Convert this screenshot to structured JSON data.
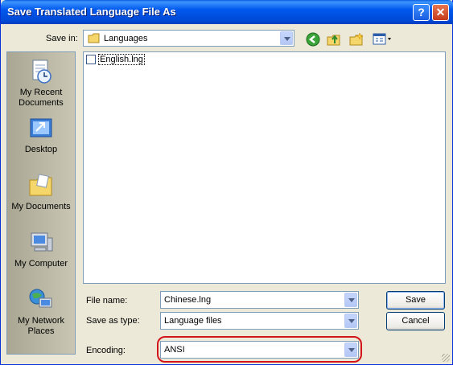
{
  "window": {
    "title": "Save Translated Language File As"
  },
  "toolbar": {
    "save_in_label": "Save in:",
    "folder": "Languages"
  },
  "places": [
    {
      "label": "My Recent Documents"
    },
    {
      "label": "Desktop"
    },
    {
      "label": "My Documents"
    },
    {
      "label": "My Computer"
    },
    {
      "label": "My Network Places"
    }
  ],
  "files": [
    {
      "name": "English.lng"
    }
  ],
  "form": {
    "file_name_label": "File name:",
    "file_name_value": "Chinese.lng",
    "save_as_type_label": "Save as type:",
    "save_as_type_value": "Language files",
    "encoding_label": "Encoding:",
    "encoding_value": "ANSI"
  },
  "buttons": {
    "save": "Save",
    "cancel": "Cancel"
  },
  "colors": {
    "title_bar": "#0058ee",
    "highlight": "#d4141b",
    "dialog_bg": "#ece9d8"
  }
}
